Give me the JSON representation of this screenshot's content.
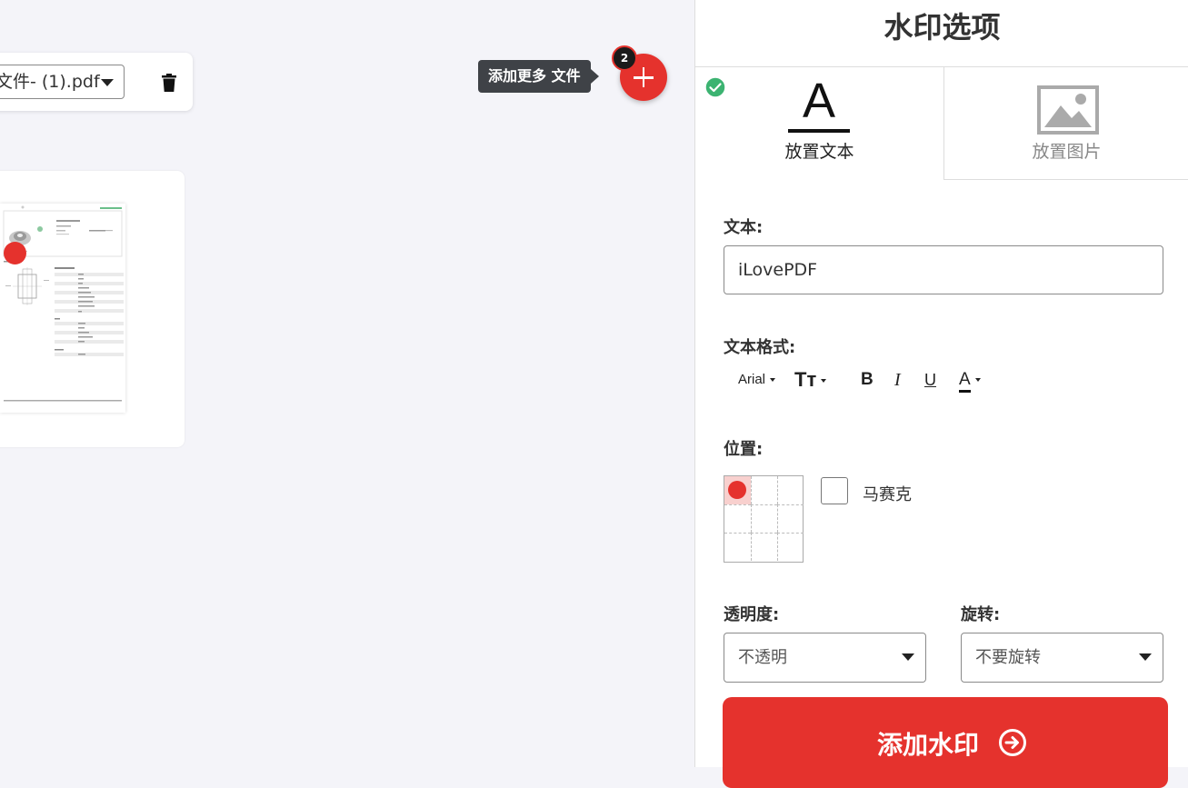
{
  "workspace": {
    "file_select": {
      "value": "文件- (1).pdf"
    },
    "add_more_tooltip": "添加更多 文件",
    "file_count": "2"
  },
  "panel": {
    "title": "水印选项",
    "tabs": [
      {
        "label": "放置文本",
        "active": true
      },
      {
        "label": "放置图片",
        "active": false
      }
    ],
    "text_label": "文本:",
    "text_value": "iLovePDF",
    "format_label": "文本格式:",
    "format": {
      "font": "Arial",
      "size_icon": "Tт",
      "bold": "B",
      "italic": "I",
      "underline": "U",
      "color_icon": "A"
    },
    "position_label": "位置:",
    "position_selected": "top-left",
    "mosaic_label": "马赛克",
    "opacity_label": "透明度:",
    "opacity_value": "不透明",
    "rotation_label": "旋转:",
    "rotation_value": "不要旋转",
    "submit_label": "添加水印"
  },
  "colors": {
    "accent": "#e5322d",
    "check_green": "#3cb371",
    "tooltip_bg": "#3f4247"
  }
}
